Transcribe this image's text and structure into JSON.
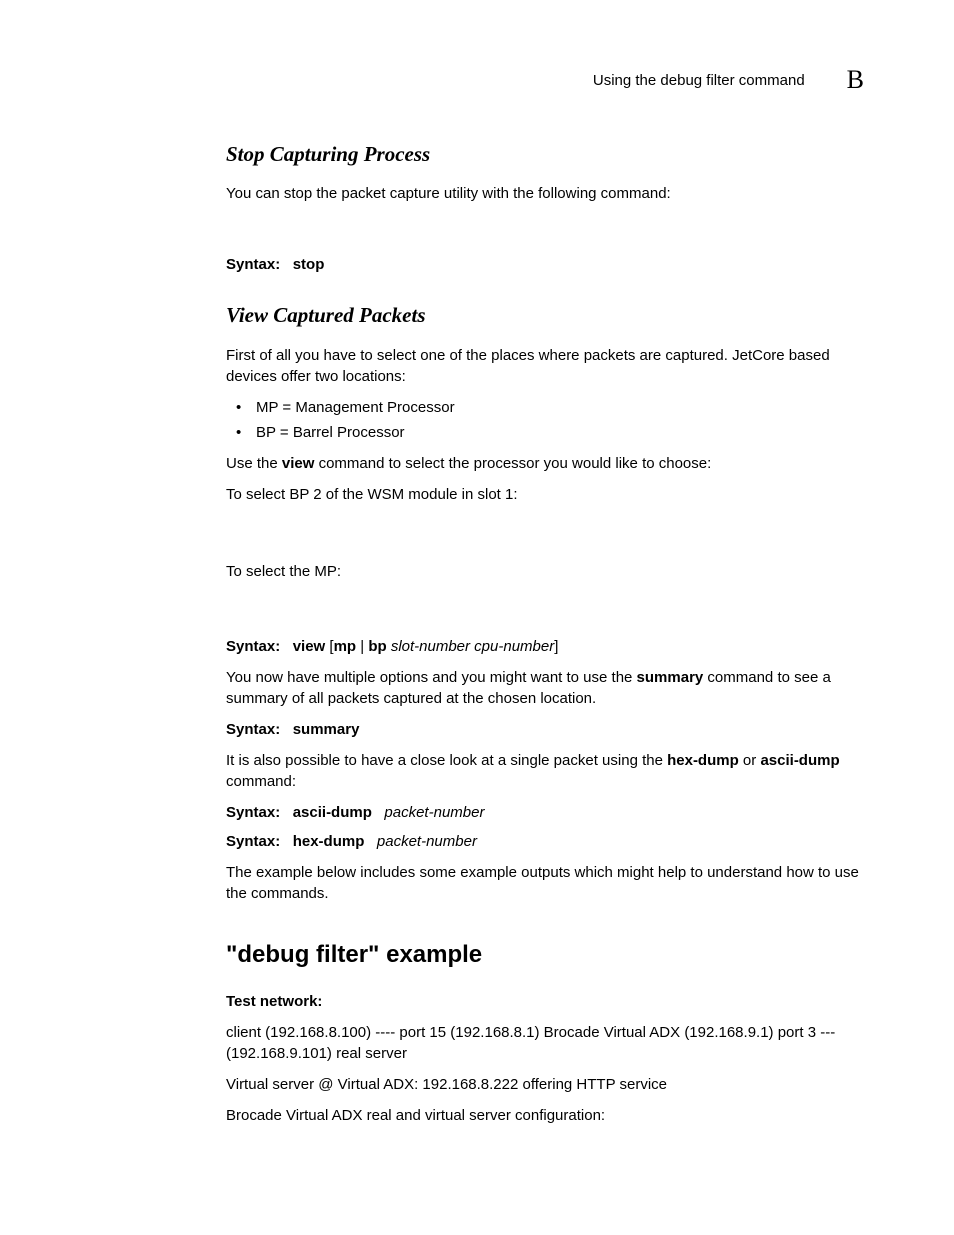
{
  "header": {
    "running_title": "Using the debug filter command",
    "appendix_letter": "B"
  },
  "sec1": {
    "title": "Stop Capturing Process",
    "intro": "You can stop the packet capture utility with the following command:",
    "syntax_label": "Syntax:",
    "syntax_cmd": "stop"
  },
  "sec2": {
    "title": "View Captured Packets",
    "p1": "First of all you have to select one of the places where packets are captured. JetCore based devices offer two locations:",
    "b1": "MP = Management Processor",
    "b2": "BP = Barrel Processor",
    "p2a": "Use the ",
    "p2_bold": "view",
    "p2b": " command to select the processor you would like to choose:",
    "p3": "To select BP 2 of the WSM module in slot 1:",
    "p4": "To select the MP:",
    "syntax_view": {
      "label": "Syntax:",
      "cmd1": "view",
      "bracket_open": " [",
      "cmd2": "mp",
      "pipe": " | ",
      "cmd3": "bp",
      "space": " ",
      "arg": "slot-number cpu-number",
      "bracket_close": "]"
    },
    "p5a": "You now have multiple options and you might want to use the ",
    "p5_bold": "summary",
    "p5b": " command to see a summary of all packets captured at the chosen location.",
    "syntax_summary": {
      "label": "Syntax:",
      "cmd": "summary"
    },
    "p6a": "It is also possible to have a close look at a single packet using the ",
    "p6_b1": "hex-dump",
    "p6_mid": " or ",
    "p6_b2": "ascii-dump",
    "p6b": " command:",
    "syntax_ascii": {
      "label": "Syntax:",
      "cmd": "ascii-dump",
      "arg": "packet-number"
    },
    "syntax_hex": {
      "label": "Syntax:",
      "cmd": "hex-dump",
      "arg": "packet-number"
    },
    "p7": "The example below includes some example outputs which might help to understand how to use the commands."
  },
  "sec3": {
    "title": "\"debug filter\" example",
    "subhead": "Test network:",
    "p1": "client (192.168.8.100) ---- port 15 (192.168.8.1) Brocade Virtual ADX (192.168.9.1) port 3 --- (192.168.9.101) real server",
    "p2": "Virtual server @ Virtual ADX: 192.168.8.222 offering HTTP service",
    "p3": "Brocade Virtual ADX real and virtual server configuration:"
  }
}
